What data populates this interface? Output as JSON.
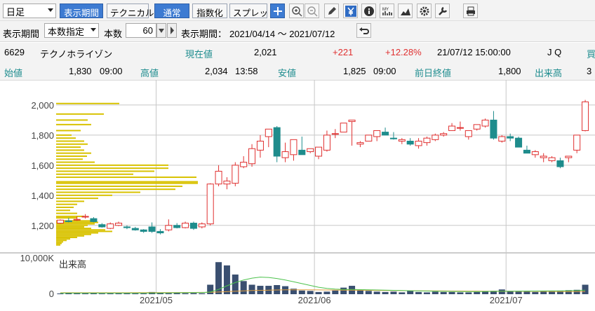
{
  "toolbar": {
    "period_select": "日足",
    "btn_display_period": "表示期間",
    "btn_technical": "テクニカル",
    "btn_normal": "通常",
    "btn_index": "指数化",
    "btn_spread": "スプレッド",
    "icons": [
      "plus-icon",
      "zoom-in-icon",
      "zoom-out-icon",
      "pencil-icon",
      "yen-icon",
      "info-icon",
      "my-icon",
      "mountain-chart-icon",
      "gear-icon",
      "wrench-icon",
      "print-icon"
    ]
  },
  "toolbar2": {
    "label_period": "表示期間",
    "mode_select": "本数指定",
    "label_count": "本数",
    "count": "60",
    "label_range": "表示期間：",
    "range": "2021/04/14 ～ 2021/07/12"
  },
  "quote": {
    "code": "6629",
    "name": "テクノホライゾン",
    "price_label": "現在値",
    "price": "2,021",
    "change": "+221",
    "change_pct": "+12.28%",
    "datetime": "21/07/12  15:00:00",
    "market": "J Q",
    "cut_label": "買",
    "open_label": "始値",
    "open": "1,830",
    "open_time": "09:00",
    "high_label": "高値",
    "high": "2,034",
    "high_time": "13:58",
    "low_label": "安値",
    "low": "1,825",
    "low_time": "09:00",
    "prev_label": "前日終値",
    "prev": "1,800",
    "vol_label": "出来高",
    "vol_cut": "3"
  },
  "chart_data": {
    "type": "candlestick",
    "price_ylim": [
      1050,
      2130
    ],
    "yticks": [
      "1,200",
      "1,400",
      "1,600",
      "1,800",
      "2,000"
    ],
    "ytick_values": [
      1200,
      1400,
      1600,
      1800,
      2000
    ],
    "xticks": [
      "2021/05",
      "2021/06",
      "2021/07"
    ],
    "xtick_index": [
      12,
      31,
      54
    ],
    "volume_label": "出来高",
    "volume_ticks": [
      "10,000K",
      "0"
    ],
    "volume_max": 10000,
    "candles": [
      [
        1215,
        1240,
        1210,
        1235
      ],
      [
        1230,
        1250,
        1220,
        1225
      ],
      [
        1235,
        1260,
        1230,
        1240
      ],
      [
        1255,
        1275,
        1245,
        1260
      ],
      [
        1245,
        1255,
        1220,
        1225
      ],
      [
        1205,
        1215,
        1185,
        1190
      ],
      [
        1180,
        1220,
        1175,
        1210
      ],
      [
        1200,
        1225,
        1195,
        1215
      ],
      [
        1190,
        1200,
        1175,
        1185
      ],
      [
        1180,
        1190,
        1165,
        1170
      ],
      [
        1170,
        1175,
        1150,
        1160
      ],
      [
        1190,
        1220,
        1150,
        1160
      ],
      [
        1160,
        1175,
        1140,
        1150
      ],
      [
        1170,
        1240,
        1160,
        1200
      ],
      [
        1200,
        1215,
        1180,
        1185
      ],
      [
        1185,
        1225,
        1180,
        1215
      ],
      [
        1215,
        1225,
        1170,
        1180
      ],
      [
        1190,
        1220,
        1180,
        1210
      ],
      [
        1210,
        1480,
        1200,
        1475
      ],
      [
        1475,
        1600,
        1460,
        1560
      ],
      [
        1475,
        1520,
        1440,
        1495
      ],
      [
        1480,
        1620,
        1460,
        1600
      ],
      [
        1590,
        1660,
        1580,
        1620
      ],
      [
        1610,
        1740,
        1590,
        1710
      ],
      [
        1700,
        1800,
        1650,
        1760
      ],
      [
        1790,
        1840,
        1720,
        1840
      ],
      [
        1850,
        1860,
        1620,
        1660
      ],
      [
        1650,
        1750,
        1620,
        1690
      ],
      [
        1670,
        1750,
        1630,
        1770
      ],
      [
        1700,
        1790,
        1680,
        1670
      ],
      [
        1690,
        1700,
        1680,
        1710
      ],
      [
        1660,
        1700,
        1640,
        1720
      ],
      [
        1700,
        1830,
        1690,
        1800
      ],
      [
        1805,
        1840,
        1780,
        1810
      ],
      [
        1820,
        1870,
        1880,
        1880
      ],
      [
        1890,
        1900,
        1730,
        1900
      ],
      [
        1740,
        1760,
        1720,
        1750
      ],
      [
        1760,
        1800,
        1760,
        1800
      ],
      [
        1790,
        1830,
        1760,
        1830
      ],
      [
        1820,
        1850,
        1800,
        1800
      ],
      [
        1780,
        1820,
        1770,
        1775
      ],
      [
        1760,
        1780,
        1740,
        1770
      ],
      [
        1760,
        1780,
        1730,
        1740
      ],
      [
        1730,
        1780,
        1710,
        1760
      ],
      [
        1750,
        1790,
        1730,
        1780
      ],
      [
        1770,
        1810,
        1760,
        1800
      ],
      [
        1800,
        1820,
        1790,
        1810
      ],
      [
        1830,
        1880,
        1830,
        1860
      ],
      [
        1850,
        1890,
        1830,
        1850
      ],
      [
        1790,
        1830,
        1770,
        1830
      ],
      [
        1840,
        1870,
        1830,
        1870
      ],
      [
        1860,
        1910,
        1850,
        1900
      ],
      [
        1900,
        1960,
        1770,
        1780
      ],
      [
        1760,
        1800,
        1750,
        1790
      ],
      [
        1790,
        1810,
        1760,
        1780
      ],
      [
        1780,
        1790,
        1720,
        1720
      ],
      [
        1700,
        1730,
        1680,
        1680
      ],
      [
        1670,
        1700,
        1650,
        1690
      ],
      [
        1650,
        1680,
        1620,
        1660
      ],
      [
        1630,
        1660,
        1620,
        1650
      ],
      [
        1630,
        1650,
        1580,
        1590
      ],
      [
        1650,
        1660,
        1620,
        1660
      ],
      [
        1700,
        1800,
        1680,
        1800
      ],
      [
        1830,
        2034,
        1825,
        2021
      ]
    ],
    "volumes": [
      200,
      300,
      250,
      220,
      260,
      180,
      200,
      210,
      230,
      200,
      190,
      600,
      300,
      250,
      280,
      260,
      300,
      240,
      2600,
      8800,
      7900,
      5400,
      3600,
      2600,
      2300,
      2300,
      2500,
      2200,
      1500,
      1000,
      900,
      600,
      700,
      1000,
      1800,
      2300,
      1200,
      900,
      700,
      600,
      700,
      500,
      900,
      600,
      500,
      700,
      600,
      600,
      500,
      500,
      600,
      700,
      900,
      1300,
      800,
      700,
      700,
      600,
      700,
      800,
      900,
      1100,
      1200,
      2600
    ],
    "volume_ma": [
      300,
      300,
      300,
      300,
      300,
      300,
      300,
      300,
      300,
      300,
      300,
      320,
      340,
      360,
      380,
      400,
      420,
      440,
      600,
      1300,
      2300,
      3200,
      3900,
      4400,
      4700,
      4600,
      4300,
      3900,
      3400,
      2900,
      2400,
      1900,
      1600,
      1400,
      1300,
      1300,
      1250,
      1200,
      1150,
      1100,
      1050,
      1000,
      950,
      900,
      860,
      820,
      780,
      760,
      750,
      740,
      740,
      750,
      780,
      800,
      820,
      840,
      860,
      870,
      880,
      900,
      930,
      960,
      1000,
      1100
    ],
    "volume_ma_long": [
      400,
      400,
      400,
      400,
      400,
      400,
      400,
      400,
      410,
      420,
      430,
      440,
      450,
      460,
      470,
      480,
      490,
      500,
      520,
      600,
      700,
      800,
      900,
      1000,
      1050,
      1100,
      1150,
      1200,
      1200,
      1200,
      1200,
      1180,
      1160,
      1140,
      1120,
      1100,
      1080,
      1060,
      1040,
      1020,
      1000,
      980,
      960,
      940,
      920,
      900,
      880,
      870,
      860,
      850,
      840,
      830,
      820,
      810,
      800,
      790,
      780,
      770,
      760,
      750,
      740,
      730,
      720,
      710
    ],
    "price_by_volume": [
      [
        2010,
        90
      ],
      [
        1940,
        68
      ],
      [
        1900,
        45
      ],
      [
        1870,
        50
      ],
      [
        1830,
        35
      ],
      [
        1800,
        22
      ],
      [
        1780,
        28
      ],
      [
        1760,
        40
      ],
      [
        1740,
        45
      ],
      [
        1720,
        35
      ],
      [
        1700,
        40
      ],
      [
        1680,
        50
      ],
      [
        1660,
        44
      ],
      [
        1640,
        38
      ],
      [
        1620,
        55
      ],
      [
        1600,
        160
      ],
      [
        1580,
        160
      ],
      [
        1560,
        140
      ],
      [
        1540,
        110
      ],
      [
        1520,
        200
      ],
      [
        1490,
        202
      ],
      [
        1480,
        202
      ],
      [
        1460,
        180
      ],
      [
        1440,
        170
      ],
      [
        1420,
        120
      ],
      [
        1400,
        80
      ],
      [
        1380,
        60
      ],
      [
        1360,
        40
      ],
      [
        1340,
        30
      ],
      [
        1320,
        25
      ],
      [
        1300,
        20
      ],
      [
        1280,
        30
      ],
      [
        1260,
        40
      ],
      [
        1250,
        30
      ],
      [
        1230,
        50
      ],
      [
        1220,
        60
      ],
      [
        1210,
        55
      ],
      [
        1200,
        45
      ],
      [
        1190,
        40
      ],
      [
        1180,
        50
      ],
      [
        1170,
        70
      ],
      [
        1160,
        80
      ],
      [
        1150,
        60
      ],
      [
        1140,
        50
      ],
      [
        1130,
        40
      ],
      [
        1120,
        30
      ],
      [
        1110,
        20
      ],
      [
        1100,
        15
      ],
      [
        1090,
        10
      ],
      [
        1080,
        8
      ],
      [
        1070,
        6
      ]
    ],
    "colors": {
      "up": "#e03030",
      "down": "#1e8c8c",
      "volume": "#3a4f70",
      "vol_ma_short": "#4cc24c",
      "vol_ma_long": "#e0a040",
      "pbv": "#d8c200",
      "grid": "#c8c8c8"
    }
  }
}
